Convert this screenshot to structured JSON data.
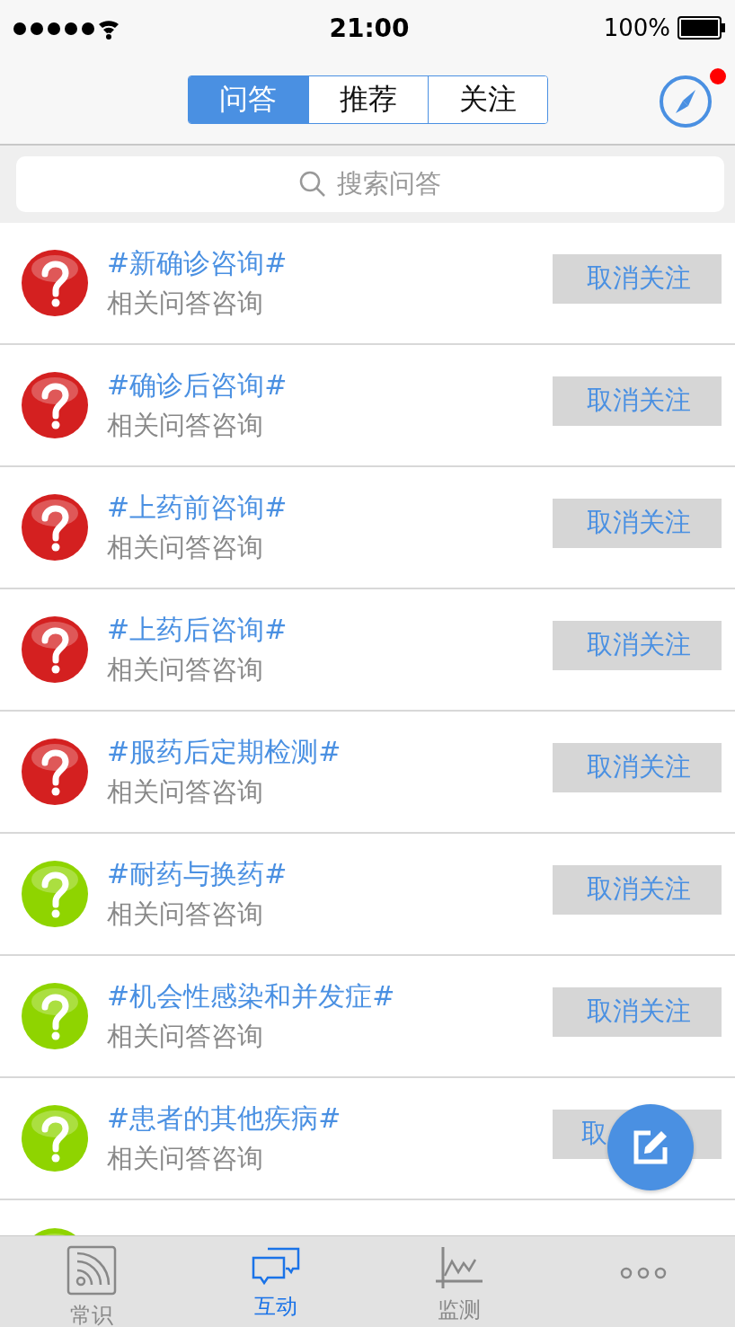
{
  "status_bar": {
    "time": "21:00",
    "battery": "100%"
  },
  "nav": {
    "tabs": [
      {
        "label": "问答",
        "selected": true
      },
      {
        "label": "推荐",
        "selected": false
      },
      {
        "label": "关注",
        "selected": false
      }
    ],
    "compass_badge": true
  },
  "search": {
    "placeholder": "搜索问答"
  },
  "topics": [
    {
      "title": "#新确诊咨询#",
      "subtitle": "相关问答咨询",
      "color": "#d42020",
      "action": "取消关注"
    },
    {
      "title": "#确诊后咨询#",
      "subtitle": "相关问答咨询",
      "color": "#d42020",
      "action": "取消关注"
    },
    {
      "title": "#上药前咨询#",
      "subtitle": "相关问答咨询",
      "color": "#d42020",
      "action": "取消关注"
    },
    {
      "title": "#上药后咨询#",
      "subtitle": "相关问答咨询",
      "color": "#d42020",
      "action": "取消关注"
    },
    {
      "title": "#服药后定期检测#",
      "subtitle": "相关问答咨询",
      "color": "#d42020",
      "action": "取消关注"
    },
    {
      "title": "#耐药与换药#",
      "subtitle": "相关问答咨询",
      "color": "#8fd400",
      "action": "取消关注"
    },
    {
      "title": "#机会性感染和并发症#",
      "subtitle": "相关问答咨询",
      "color": "#8fd400",
      "action": "取消关注"
    },
    {
      "title": "#患者的其他疾病#",
      "subtitle": "相关问答咨询",
      "color": "#8fd400",
      "action": "取"
    },
    {
      "color": "#8fd400"
    }
  ],
  "tab_bar": [
    {
      "kind": "feed",
      "label": "常识",
      "selected": false
    },
    {
      "kind": "chat",
      "label": "互动",
      "selected": true
    },
    {
      "kind": "chart",
      "label": "监测",
      "selected": false
    },
    {
      "kind": "more",
      "selected": false
    }
  ]
}
